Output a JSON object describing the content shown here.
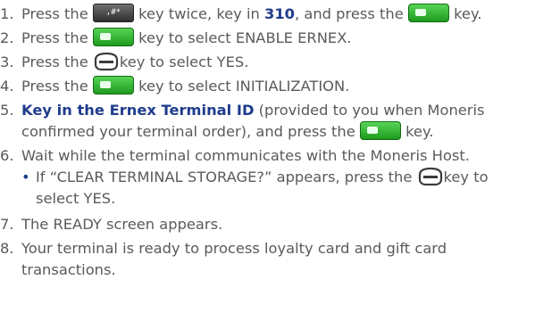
{
  "steps": [
    {
      "number": "1.",
      "before": "Press the ",
      "mid1": " key twice, key in ",
      "bold": "310",
      "mid2": ", and press the ",
      "after": " key."
    },
    {
      "number": "2.",
      "before": "Press the ",
      "after": " key to select ENABLE ERNEX."
    },
    {
      "number": "3.",
      "before": "Press the ",
      "after": "key to select YES."
    },
    {
      "number": "4.",
      "before": "Press the ",
      "after": " key to select INITIALIZATION."
    },
    {
      "number": "5.",
      "bold": "Key in the Ernex Terminal ID",
      "line1": " (provided to you when Moneris",
      "line2_before": "confirmed your terminal order), and press the ",
      "line2_after": " key."
    },
    {
      "number": "6.",
      "line1": "Wait while the terminal communicates with the Moneris Host."
    },
    {
      "number": "7.",
      "line1": "The READY screen appears."
    },
    {
      "number": "8.",
      "line1": "Your terminal is ready to process loyalty card and gift card",
      "line2": "transactions."
    }
  ],
  "substep": {
    "bullet": "•",
    "line1_before": "If “CLEAR TERMINAL STORAGE?” appears, press the ",
    "line1_after": "key to",
    "line2": "select YES."
  },
  "keys": {
    "function_key_label": ",#*",
    "ok_key_color": "#2fb52f",
    "function_key_color": "#3b3b3b",
    "soft_key_color": "#3b3b3b"
  }
}
